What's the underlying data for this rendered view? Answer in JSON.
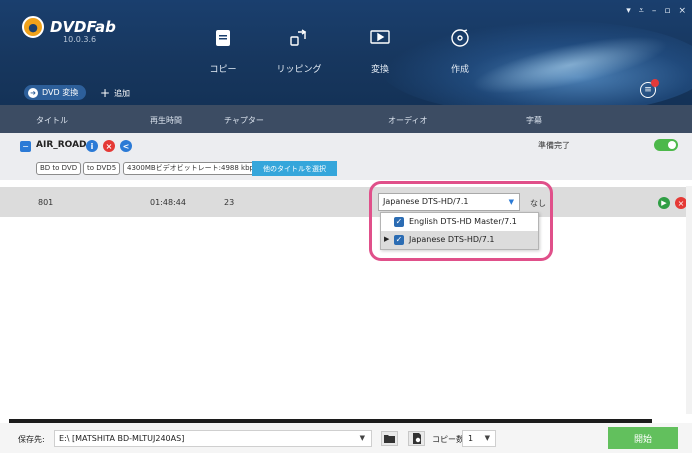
{
  "app": {
    "name": "DVDFab",
    "version": "10.0.3.6"
  },
  "window_controls": [
    "▾",
    "⩡",
    "–",
    "▫",
    "×"
  ],
  "nav": [
    {
      "label": "コピー",
      "icon": "copy-icon"
    },
    {
      "label": "リッピング",
      "icon": "ripper-icon"
    },
    {
      "label": "変換",
      "icon": "converter-icon"
    },
    {
      "label": "作成",
      "icon": "creator-icon"
    }
  ],
  "toolbar": {
    "source_label": "DVD 変換",
    "add_label": "追加"
  },
  "columns": [
    "タイトル",
    "再生時間",
    "チャプター",
    "オーディオ",
    "字幕"
  ],
  "title_row": {
    "name": "AIR_ROAD",
    "status": "準備完了",
    "tags": [
      "BD to DVD",
      "to DVD5",
      "4300MBビデオビットレート:4988 kbps"
    ],
    "other_titles_label": "他のタイトルを選択"
  },
  "track": {
    "title": "801",
    "duration": "01:48:44",
    "chapters": "23",
    "audio_selected": "Japanese DTS-HD/7.1",
    "subtitle": "なし"
  },
  "audio_options": [
    {
      "label": "English DTS-HD Master/7.1",
      "checked": true
    },
    {
      "label": "Japanese DTS-HD/7.1",
      "checked": true
    }
  ],
  "bottom": {
    "save_label": "保存先:",
    "save_path": "E:\\ [MATSHITA BD-MLTUJ240AS]",
    "copies_label": "コピー数:",
    "copies_value": "1",
    "start_label": "開始"
  },
  "colors": {
    "header_bg": "#1a3f6e",
    "accent": "#2b7ad6",
    "highlight_border": "#e0508a",
    "start_button": "#62c05d"
  }
}
